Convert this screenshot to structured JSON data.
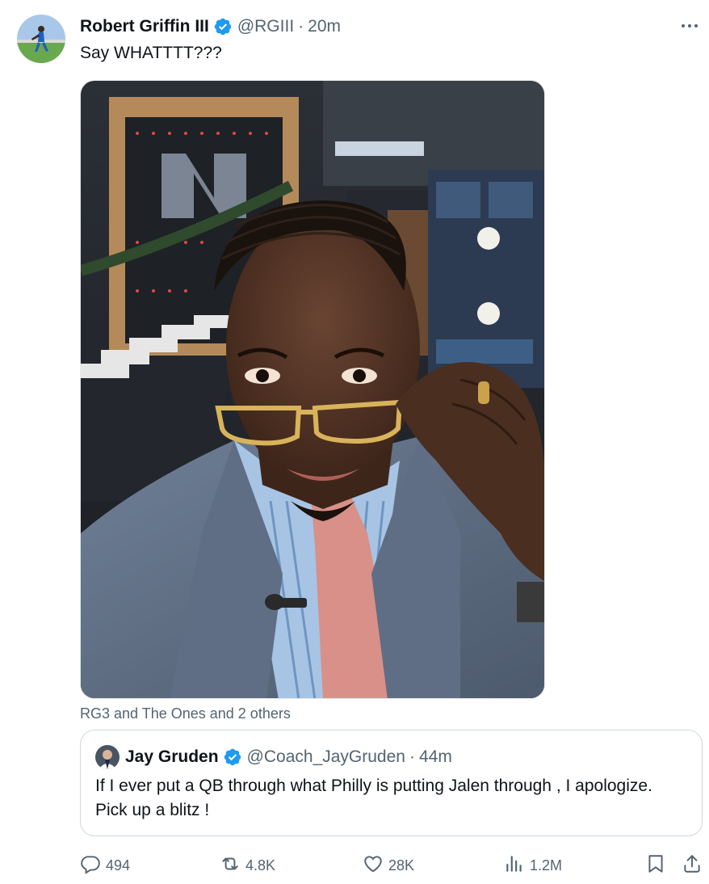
{
  "tweet": {
    "author_name": "Robert Griffin III",
    "handle": "@RGIII",
    "separator": "·",
    "time": "20m",
    "text": "Say WHATTTT???",
    "media_tags": "RG3 and The Ones and 2 others"
  },
  "quoted": {
    "author_name": "Jay Gruden",
    "handle": "@Coach_JayGruden",
    "separator": "·",
    "time": "44m",
    "text": "If I ever put a QB through what Philly is putting Jalen through , I apologize.     Pick up a blitz !"
  },
  "actions": {
    "replies": "494",
    "reposts": "4.8K",
    "likes": "28K",
    "views": "1.2M"
  },
  "icons": {
    "more": "more-icon",
    "verified": "verified-badge-icon",
    "reply": "reply-icon",
    "repost": "repost-icon",
    "like": "heart-icon",
    "views": "views-icon",
    "bookmark": "bookmark-icon",
    "share": "share-icon"
  },
  "colors": {
    "verified": "#1d9bf0",
    "text_primary": "#0f1419",
    "text_secondary": "#536471",
    "border": "#cfd9de"
  }
}
